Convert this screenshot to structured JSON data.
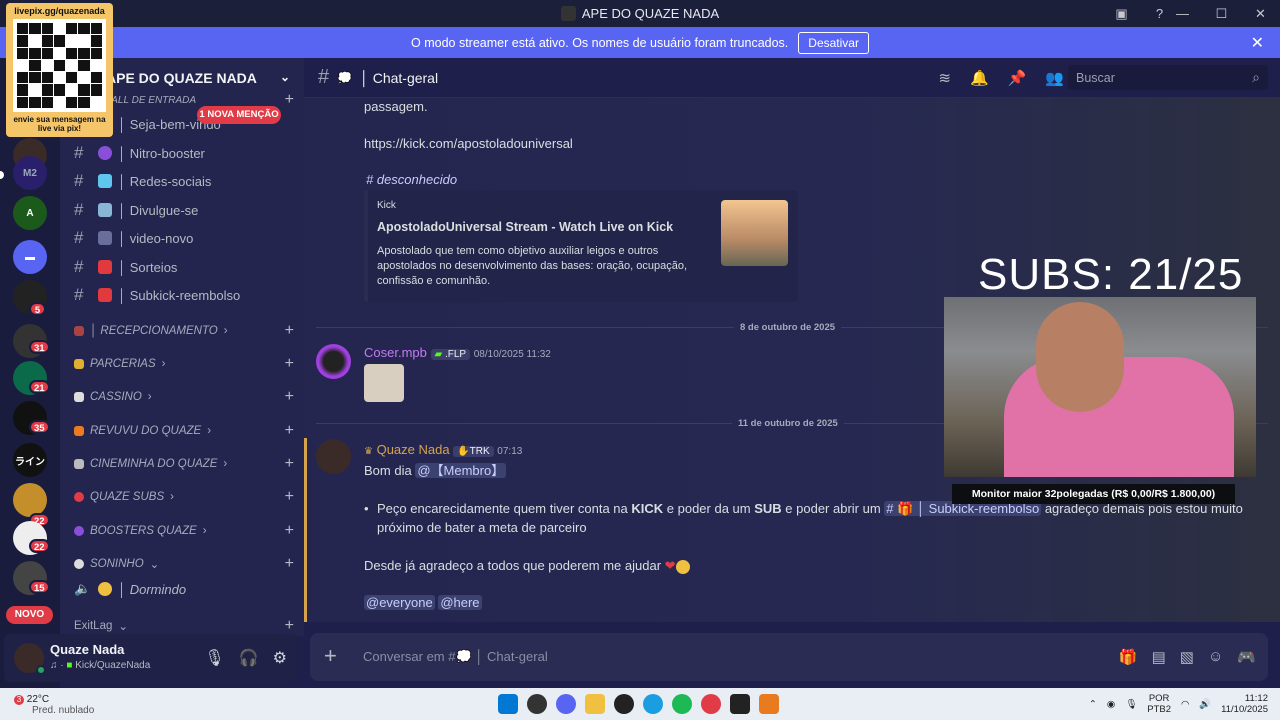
{
  "window": {
    "title": "APE DO QUAZE NADA"
  },
  "banner": {
    "text": "O modo streamer está ativo. Os nomes de usuário foram truncados.",
    "button": "Desativar"
  },
  "qr_overlay": {
    "top": "livepix.gg/quazenada",
    "bottom": "envie sua mensagem na live via pix!"
  },
  "servers": {
    "badges": [
      "5",
      "31",
      "21",
      "35",
      "22",
      "22",
      "15"
    ],
    "novo": "NOVO"
  },
  "server_header": {
    "name": "APE DO QUAZE NADA"
  },
  "mention_badge": "1 NOVA MENÇÃO",
  "channels": [
    {
      "label": "HALL DE ENTRADA"
    },
    {
      "label": "│ Seja-bem-vindo"
    },
    {
      "label": "│ Nitro-booster"
    },
    {
      "label": "│ Redes-sociais"
    },
    {
      "label": "│ Divulgue-se"
    },
    {
      "label": "│ video-novo"
    },
    {
      "label": "│ Sorteios"
    },
    {
      "label": "│ Subkick-reembolso"
    }
  ],
  "categories": [
    "│ RECEPCIONAMENTO",
    "PARCERIAS",
    "CASSINO",
    "REVUVU DO QUAZE",
    "CINEMINHA DO QUAZE",
    "QUAZE SUBS",
    "BOOSTERS QUAZE",
    "SONINHO"
  ],
  "voice_channel": "│ Dormindo",
  "exitlag": "ExitLag",
  "user": {
    "name": "Quaze Nada",
    "status": "Kick/QuazeNada"
  },
  "chat_header": {
    "channel": "│ Chat-geral",
    "search_placeholder": "Buscar"
  },
  "messages": {
    "prev_text": "passagem.",
    "prev_link": "https://kick.com/apostoladouniversal",
    "channel_mention": "# desconhecido",
    "embed": {
      "provider": "Kick",
      "title": "ApostoladoUniversal Stream - Watch Live on Kick",
      "description": "Apostolado que tem como objetivo auxiliar leigos e outros apostolados no desenvolvimento das bases: oração, ocupação, confissão e comunhão."
    },
    "date1": "8 de outubro de 2025",
    "msg1": {
      "author": "Coser.mpb",
      "tag": ".FLP",
      "time": "08/10/2025 11:32"
    },
    "date2": "11 de outubro de 2025",
    "msg2": {
      "author": "Quaze Nada",
      "tag": "TRK",
      "time": "07:13",
      "line1": "Bom dia",
      "role_mention": "@【Membro】",
      "bullet_a": "Peço encarecidamente quem tiver conta na ",
      "bullet_kick": "KICK",
      "bullet_b": " e poder da um ",
      "bullet_sub": "SUB",
      "bullet_c": " e poder abrir um ",
      "bullet_channel": "# 🎁 │ Subkick-reembolso",
      "bullet_d": " agradeço demais pois estou muito próximo de bater a meta de parceiro",
      "thanks": "Desde já agradeço a todos que poderem me ajudar",
      "everyone": "@everyone",
      "here": "@here"
    }
  },
  "stream_overlay": {
    "subs": "SUBS: 21/25",
    "goal": "Monitor maior 32polegadas (R$ 0,00/R$ 1.800,00)"
  },
  "composer": {
    "placeholder": "Conversar em #💭 │ Chat-geral"
  },
  "taskbar": {
    "temp": "22°C",
    "weather": "Pred. nublado",
    "weather_badge": "3",
    "lang1": "POR",
    "lang2": "PTB2",
    "time": "11:12",
    "date": "11/10/2025"
  },
  "colors": {
    "accent": "#5865f2",
    "mention_red": "#e03b46",
    "link": "#6da8f5",
    "author_quaze": "#d4a34a",
    "author_coser": "#c27cf0"
  }
}
